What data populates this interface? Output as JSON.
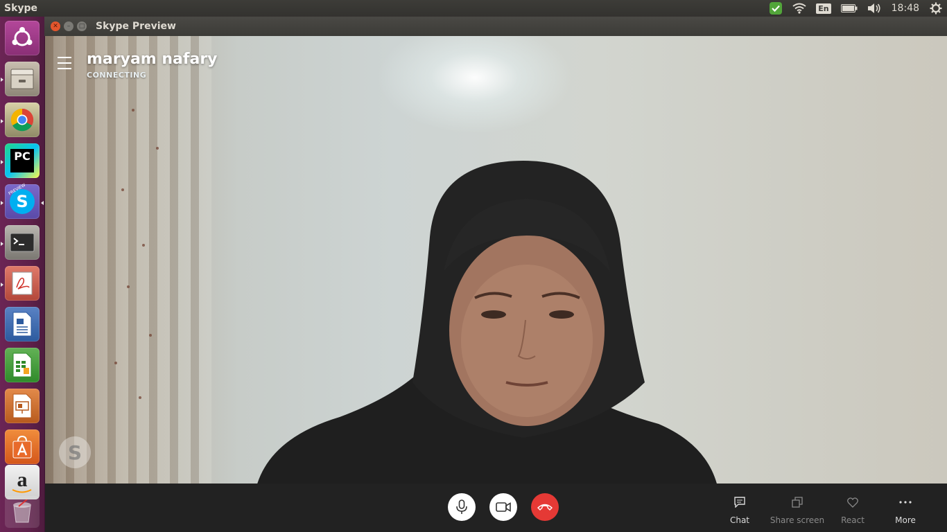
{
  "top_panel": {
    "app_name": "Skype",
    "language": "En",
    "time": "18:48"
  },
  "launcher": {
    "items": [
      "Ubuntu Dash",
      "Files",
      "Google Chrome",
      "PyCharm",
      "Skype Preview",
      "Terminal",
      "Document Viewer",
      "LibreOffice Writer",
      "LibreOffice Calc",
      "LibreOffice Impress",
      "Ubuntu Software",
      "Amazon",
      "Trash"
    ],
    "pycharm_label": "PC",
    "skype_label": "S",
    "skype_badge": "PREVIEW",
    "amazon_label": "a"
  },
  "window": {
    "title": "Skype Preview"
  },
  "call": {
    "contact_name": "maryam nafary",
    "status": "CONNECTING",
    "watermark": "S"
  },
  "actions": {
    "chat": "Chat",
    "share_screen": "Share screen",
    "react": "React",
    "more": "More"
  },
  "colors": {
    "launcher": "#5d2049",
    "hangup": "#e53935",
    "callbar": "#222222"
  }
}
